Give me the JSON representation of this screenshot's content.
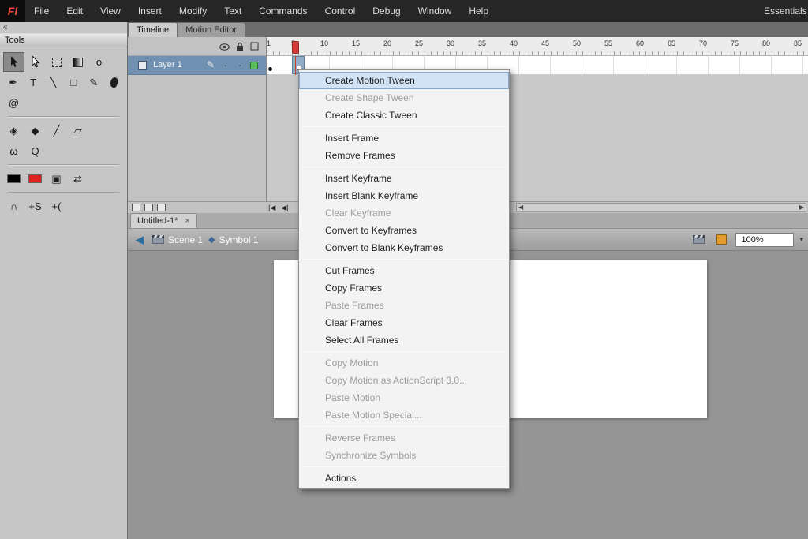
{
  "colors": {
    "menubar_bg": "#262626",
    "playhead_red": "#cf3a35",
    "fill_swatch_red": "#e02222",
    "layer_selection_blue": "#7191b3",
    "menu_highlight_blue": "#d2e3f6"
  },
  "menubar": {
    "logo": "Fl",
    "items": [
      "File",
      "Edit",
      "View",
      "Insert",
      "Modify",
      "Text",
      "Commands",
      "Control",
      "Debug",
      "Window",
      "Help"
    ],
    "workspace": "Essentials"
  },
  "tools": {
    "collapse_glyph": "«",
    "title": "Tools",
    "groups": [
      [
        [
          {
            "name": "selection-tool",
            "shape": "arrow-black",
            "selected": true
          },
          {
            "name": "subselection-tool",
            "shape": "arrow-white"
          },
          {
            "name": "free-transform-tool",
            "shape": "dashed-square"
          },
          {
            "name": "gradient-transform-tool",
            "shape": "gradient-square"
          },
          {
            "name": "lasso-tool",
            "glyph": "ϙ"
          }
        ],
        [
          {
            "name": "pen-tool",
            "glyph": "✒"
          },
          {
            "name": "text-tool",
            "glyph": "T"
          },
          {
            "name": "line-tool",
            "glyph": "╲"
          },
          {
            "name": "rectangle-tool",
            "glyph": "□"
          },
          {
            "name": "pencil-tool",
            "glyph": "✎"
          },
          {
            "name": "brush-tool",
            "shape": "brush-blob"
          }
        ],
        [
          {
            "name": "deco-tool",
            "glyph": "@"
          }
        ]
      ],
      [
        [
          {
            "name": "paint-bucket-tool",
            "glyph": "◈"
          },
          {
            "name": "ink-bottle-tool",
            "glyph": "◆"
          },
          {
            "name": "eyedropper-tool",
            "glyph": "╱"
          },
          {
            "name": "eraser-tool",
            "glyph": "▱"
          }
        ],
        [
          {
            "name": "hand-tool",
            "glyph": "ω"
          },
          {
            "name": "zoom-tool",
            "glyph": "Q"
          }
        ]
      ],
      [
        [
          {
            "name": "stroke-color-swatch",
            "shape": "swatch-black"
          },
          {
            "name": "fill-color-swatch",
            "shape": "swatch-red"
          },
          {
            "name": "black-white-button",
            "glyph": "▣"
          },
          {
            "name": "swap-colors-button",
            "glyph": "⇄"
          }
        ]
      ],
      [
        [
          {
            "name": "snap-to-objects-button",
            "glyph": "∩"
          },
          {
            "name": "smooth-button",
            "glyph": "+S"
          },
          {
            "name": "straighten-button",
            "glyph": "+("
          }
        ]
      ]
    ]
  },
  "timeline": {
    "tabs": [
      {
        "label": "Timeline",
        "active": true
      },
      {
        "label": "Motion Editor",
        "active": false
      }
    ],
    "layer": {
      "name": "Layer 1"
    },
    "ruler_ticks": [
      1,
      5,
      10,
      15,
      20,
      25,
      30,
      35,
      40,
      45,
      50,
      55,
      60,
      65,
      70,
      75,
      80,
      85
    ],
    "playhead_frame": 5,
    "statusbar": {
      "playback": [
        {
          "name": "first-frame-button",
          "glyph": "|◀"
        },
        {
          "name": "prev-frame-button",
          "glyph": "◀|"
        }
      ]
    },
    "scrollbar": {
      "left": "◀",
      "right": "▶"
    }
  },
  "document_tab": {
    "label": "Untitled-1*",
    "close": "×"
  },
  "edit_bar": {
    "back": "◀",
    "scene": "Scene 1",
    "symbol": "Symbol 1",
    "zoom": "100%",
    "zoom_arrow": "▾"
  },
  "context_menu": {
    "items": [
      {
        "label": "Create Motion Tween",
        "state": "highlighted"
      },
      {
        "label": "Create Shape Tween",
        "state": "disabled"
      },
      {
        "label": "Create Classic Tween",
        "state": "normal"
      },
      {
        "type": "separator"
      },
      {
        "label": "Insert Frame",
        "state": "normal"
      },
      {
        "label": "Remove Frames",
        "state": "normal"
      },
      {
        "type": "separator"
      },
      {
        "label": "Insert Keyframe",
        "state": "normal"
      },
      {
        "label": "Insert Blank Keyframe",
        "state": "normal"
      },
      {
        "label": "Clear Keyframe",
        "state": "disabled"
      },
      {
        "label": "Convert to Keyframes",
        "state": "normal"
      },
      {
        "label": "Convert to Blank Keyframes",
        "state": "normal"
      },
      {
        "type": "separator"
      },
      {
        "label": "Cut Frames",
        "state": "normal"
      },
      {
        "label": "Copy Frames",
        "state": "normal"
      },
      {
        "label": "Paste Frames",
        "state": "disabled"
      },
      {
        "label": "Clear Frames",
        "state": "normal"
      },
      {
        "label": "Select All Frames",
        "state": "normal"
      },
      {
        "type": "separator"
      },
      {
        "label": "Copy Motion",
        "state": "disabled"
      },
      {
        "label": "Copy Motion as ActionScript 3.0...",
        "state": "disabled"
      },
      {
        "label": "Paste Motion",
        "state": "disabled"
      },
      {
        "label": "Paste Motion Special...",
        "state": "disabled"
      },
      {
        "type": "separator"
      },
      {
        "label": "Reverse Frames",
        "state": "disabled"
      },
      {
        "label": "Synchronize Symbols",
        "state": "disabled"
      },
      {
        "type": "separator"
      },
      {
        "label": "Actions",
        "state": "normal"
      }
    ]
  }
}
